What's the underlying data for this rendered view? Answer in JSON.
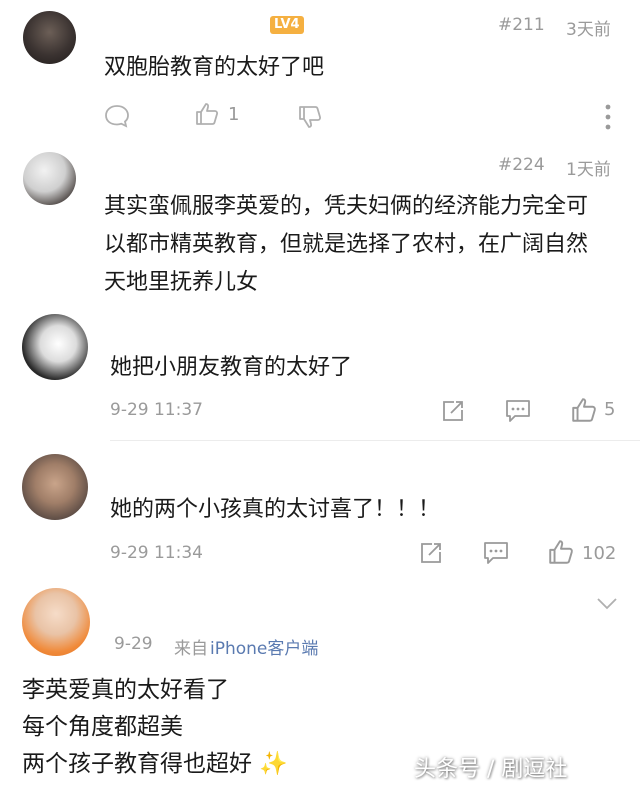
{
  "comments": [
    {
      "level_badge": "LV4",
      "floor": "#211",
      "time": "3天前",
      "text": "双胞胎教育的太好了吧",
      "like_count": "1"
    },
    {
      "floor": "#224",
      "time": "1天前",
      "lines": [
        "其实蛮佩服李英爱的，凭夫妇俩的经济能力完全可",
        "以都市精英教育，但就是选择了农村，在广阔自然",
        "天地里抚养儿女"
      ]
    },
    {
      "text": "她把小朋友教育的太好了",
      "time": "9-29 11:37",
      "like_count": "5"
    },
    {
      "text": "她的两个小孩真的太讨喜了！！！",
      "time": "9-29 11:34",
      "like_count": "102"
    },
    {
      "time_prefix": "9-29",
      "source_prefix": "来自",
      "source_device": "iPhone客户端",
      "lines": [
        "李英爱真的太好看了",
        "每个角度都超美",
        "两个孩子教育得也超好"
      ]
    }
  ],
  "watermark": "头条号 / 剧逗社",
  "colors": {
    "background": "#ffffff",
    "text": "#1a1a1a",
    "meta": "#9a9a9a",
    "link": "#5a7ab0",
    "level_badge": "#f5b041"
  }
}
